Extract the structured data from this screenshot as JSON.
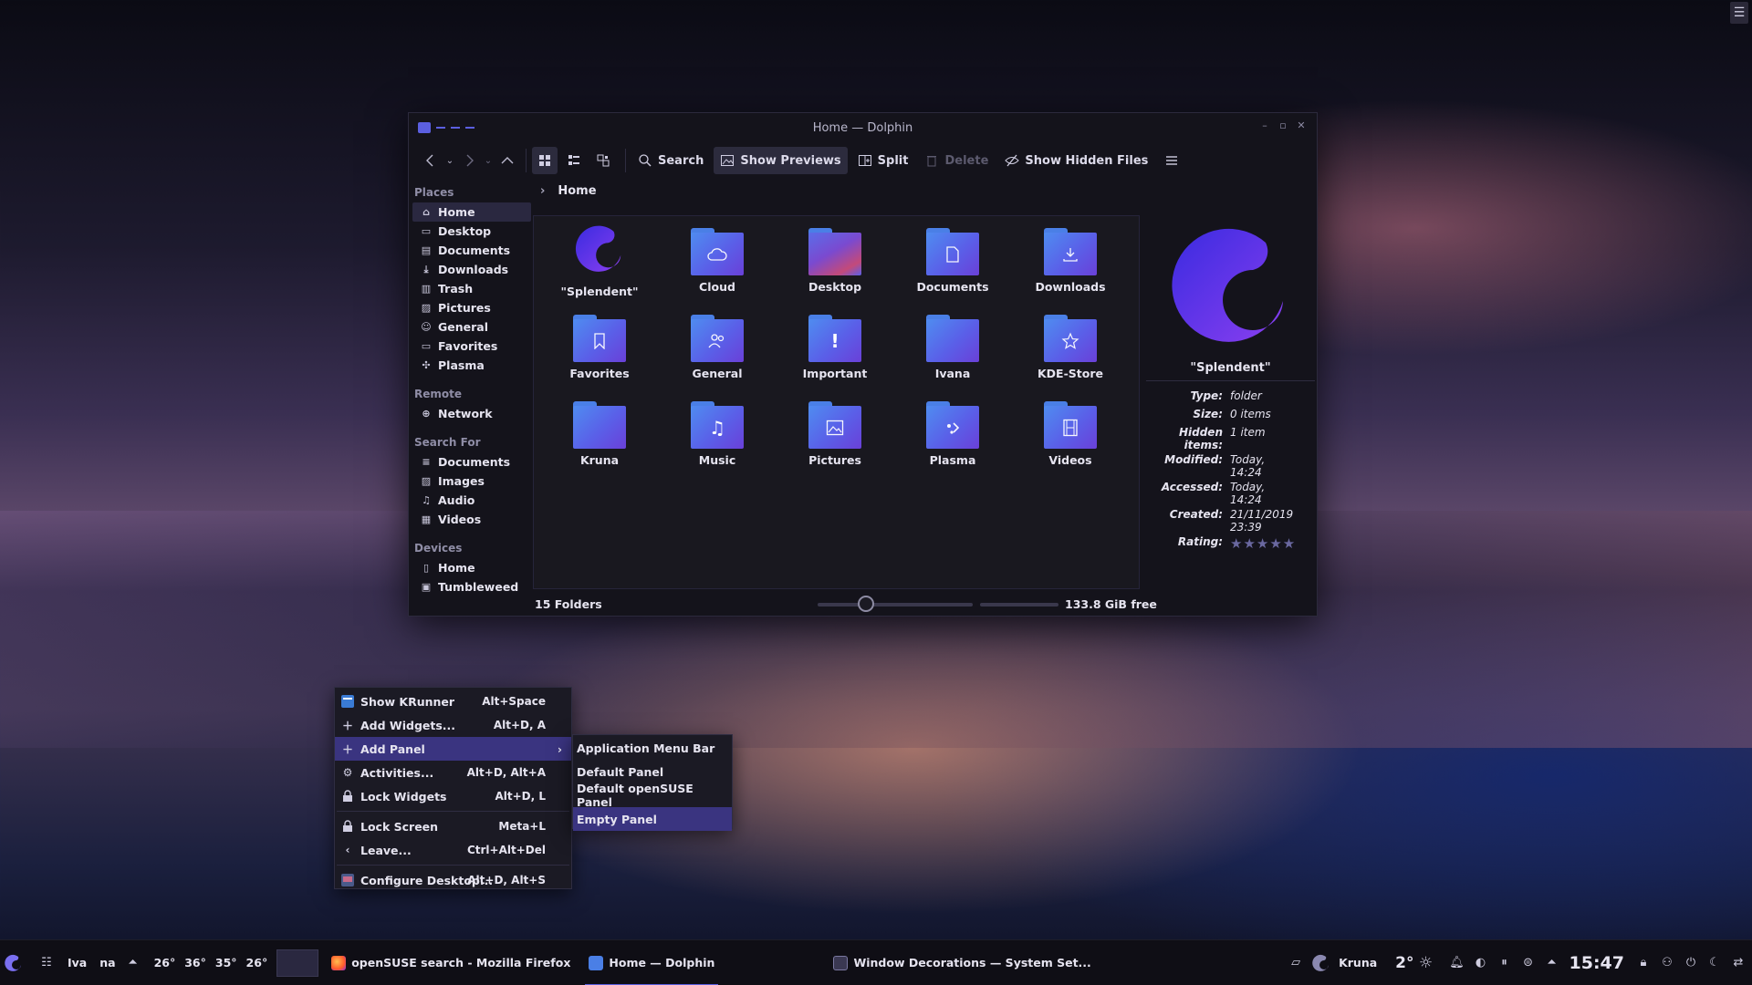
{
  "window": {
    "title": "Home — Dolphin",
    "toolbar": {
      "search": "Search",
      "show_previews": "Show Previews",
      "split": "Split",
      "delete": "Delete",
      "show_hidden": "Show Hidden Files"
    },
    "breadcrumb": "Home",
    "sidebar": {
      "places_header": "Places",
      "places": [
        "Home",
        "Desktop",
        "Documents",
        "Downloads",
        "Trash",
        "Pictures",
        "General",
        "Favorites",
        "Plasma"
      ],
      "remote_header": "Remote",
      "remote": [
        "Network"
      ],
      "search_header": "Search For",
      "search": [
        "Documents",
        "Images",
        "Audio",
        "Videos"
      ],
      "devices_header": "Devices",
      "devices": [
        "Home",
        "Tumbleweed"
      ]
    },
    "items": [
      "\"Splendent\"",
      "Cloud",
      "Desktop",
      "Documents",
      "Downloads",
      "Favorites",
      "General",
      "Important",
      "Ivana",
      "KDE-Store",
      "Kruna",
      "Music",
      "Pictures",
      "Plasma",
      "Videos"
    ],
    "status": {
      "count": "15 Folders",
      "free": "133.8 GiB free",
      "disk_used_fraction": 0.0
    },
    "info": {
      "name": "\"Splendent\"",
      "rows": [
        {
          "k": "Type:",
          "v": "folder"
        },
        {
          "k": "Size:",
          "v": "0 items"
        },
        {
          "k": "Hidden items:",
          "v": "1 item"
        },
        {
          "k": "Modified:",
          "v": "Today, 14:24"
        },
        {
          "k": "Accessed:",
          "v": "Today, 14:24"
        },
        {
          "k": "Created:",
          "v": "21/11/2019 23:39"
        }
      ],
      "rating_label": "Rating:",
      "rating_stars": 0
    }
  },
  "context_menu": {
    "items": [
      {
        "label": "Show KRunner",
        "shortcut": "Alt+Space",
        "icon": "krunner-icon"
      },
      {
        "label": "Add Widgets...",
        "shortcut": "Alt+D, A",
        "icon": "plus-icon"
      },
      {
        "label": "Add Panel",
        "shortcut": "",
        "icon": "plus-icon"
      },
      {
        "label": "Activities...",
        "shortcut": "Alt+D, Alt+A",
        "icon": "activities-icon"
      },
      {
        "label": "Lock Widgets",
        "shortcut": "Alt+D, L",
        "icon": "lock-icon"
      },
      {
        "label": "Lock Screen",
        "shortcut": "Meta+L",
        "icon": "lock-icon"
      },
      {
        "label": "Leave...",
        "shortcut": "Ctrl+Alt+Del",
        "icon": "chevron-left-icon"
      },
      {
        "label": "Configure Desktop...",
        "shortcut": "Alt+D, Alt+S",
        "icon": "configure-icon"
      }
    ],
    "submenu": [
      "Application Menu Bar",
      "Default Panel",
      "Default openSUSE Panel",
      "Empty Panel"
    ]
  },
  "taskbar": {
    "weather_loc_a": "Iva",
    "weather_loc_b": "na",
    "temps": [
      "26°",
      "36°",
      "35°",
      "26°"
    ],
    "tasks": [
      "openSUSE search - Mozilla Firefox",
      "Home — Dolphin",
      "Window Decorations — System Set..."
    ],
    "user": "Kruna",
    "weather_temp": "2°",
    "clock": "15:47"
  },
  "colors": {
    "accent": "#5b5fe0",
    "highlight": "#3a3480",
    "window_bg": "#14131b"
  }
}
